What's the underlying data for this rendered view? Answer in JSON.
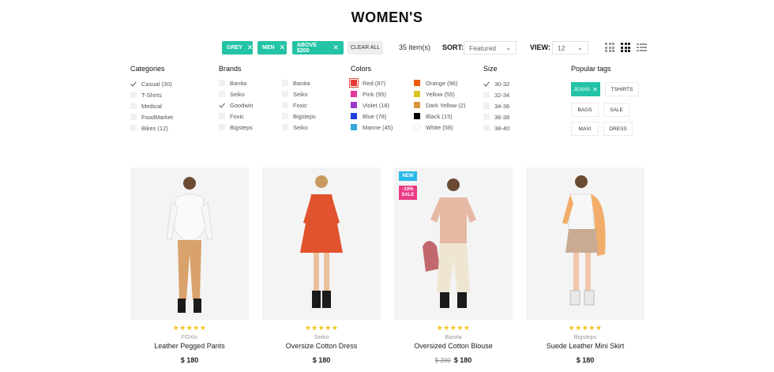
{
  "page_title": "WOMEN'S",
  "active_filters": [
    {
      "label": "GREY"
    },
    {
      "label": "MEN"
    },
    {
      "label": "ABOVE $200"
    }
  ],
  "clear_all_label": "CLEAR ALL",
  "items_count": "35 item(s)",
  "sort": {
    "label": "SORT:",
    "value": "Featured"
  },
  "view": {
    "label": "VIEW:",
    "value": "12"
  },
  "filters": {
    "categories": {
      "title": "Categories",
      "items": [
        {
          "label": "Casual (30)",
          "checked": true
        },
        {
          "label": "T-Shirts",
          "checked": false
        },
        {
          "label": "Medical",
          "checked": false
        },
        {
          "label": "FoodMarket",
          "checked": false
        },
        {
          "label": "Bikes (12)",
          "checked": false
        }
      ]
    },
    "brands": {
      "title": "Brands",
      "col1": [
        {
          "label": "Banita",
          "checked": false
        },
        {
          "label": "Seiko",
          "checked": false
        },
        {
          "label": "Goodwin",
          "checked": true
        },
        {
          "label": "Foxic",
          "checked": false
        },
        {
          "label": "Bigsteps",
          "checked": false
        }
      ],
      "col2": [
        {
          "label": "Banita",
          "checked": false
        },
        {
          "label": "Seiko",
          "checked": false
        },
        {
          "label": "Foxic",
          "checked": false
        },
        {
          "label": "Bigsteps",
          "checked": false
        },
        {
          "label": "Seiko",
          "checked": false
        }
      ]
    },
    "colors": {
      "title": "Colors",
      "col1": [
        {
          "label": "Red (87)",
          "color": "#e53935",
          "selected": true
        },
        {
          "label": "Pink (95)",
          "color": "#e2379a"
        },
        {
          "label": "Violet (18)",
          "color": "#9c36c8"
        },
        {
          "label": "Blue (78)",
          "color": "#1f3fe0"
        },
        {
          "label": "Marine (45)",
          "color": "#35a9d6"
        }
      ],
      "col2": [
        {
          "label": "Orange (96)",
          "color": "#f05a0c"
        },
        {
          "label": "Yellow (55)",
          "color": "#d8c325"
        },
        {
          "label": "Dark Yellow (2)",
          "color": "#d9973d"
        },
        {
          "label": "Black (15)",
          "color": "#000000"
        },
        {
          "label": "White (58)",
          "color": "#ffffff"
        }
      ]
    },
    "size": {
      "title": "Size",
      "items": [
        {
          "label": "30-32",
          "checked": true
        },
        {
          "label": "32-34",
          "checked": false
        },
        {
          "label": "34-36",
          "checked": false
        },
        {
          "label": "36-38",
          "checked": false
        },
        {
          "label": "38-40",
          "checked": false
        }
      ]
    },
    "tags": {
      "title": "Popular tags",
      "items": [
        {
          "label": "JEANS",
          "active": true
        },
        {
          "label": "TSHIRTS"
        },
        {
          "label": "BAGS"
        },
        {
          "label": "SALE"
        },
        {
          "label": "MAXI"
        },
        {
          "label": "DRESS"
        }
      ]
    }
  },
  "products": [
    {
      "brand": "FOXic",
      "name": "Leather Pegged Pants",
      "price": "$ 180",
      "old_price": "",
      "rating": "★★★★★",
      "badges": []
    },
    {
      "brand": "Seiko",
      "name": "Oversize Cotton Dress",
      "price": "$ 180",
      "old_price": "",
      "rating": "★★★★★",
      "badges": []
    },
    {
      "brand": "Banita",
      "name": "Oversized Cotton Blouse",
      "price": "$ 180",
      "old_price": "$ 200",
      "rating": "★★★★★",
      "badges": [
        {
          "type": "new",
          "text": "NEW"
        },
        {
          "type": "sale",
          "text": "-10% SALE"
        }
      ]
    },
    {
      "brand": "Bigsteps",
      "name": "Suede Leather Mini Skirt",
      "price": "$ 180",
      "old_price": "",
      "rating": "★★★★★",
      "badges": []
    }
  ],
  "colors": {
    "accent": "#23c3a6",
    "new_badge": "#2ab9e8",
    "sale_badge": "#ea3a86",
    "stars": "#f7c21b"
  }
}
